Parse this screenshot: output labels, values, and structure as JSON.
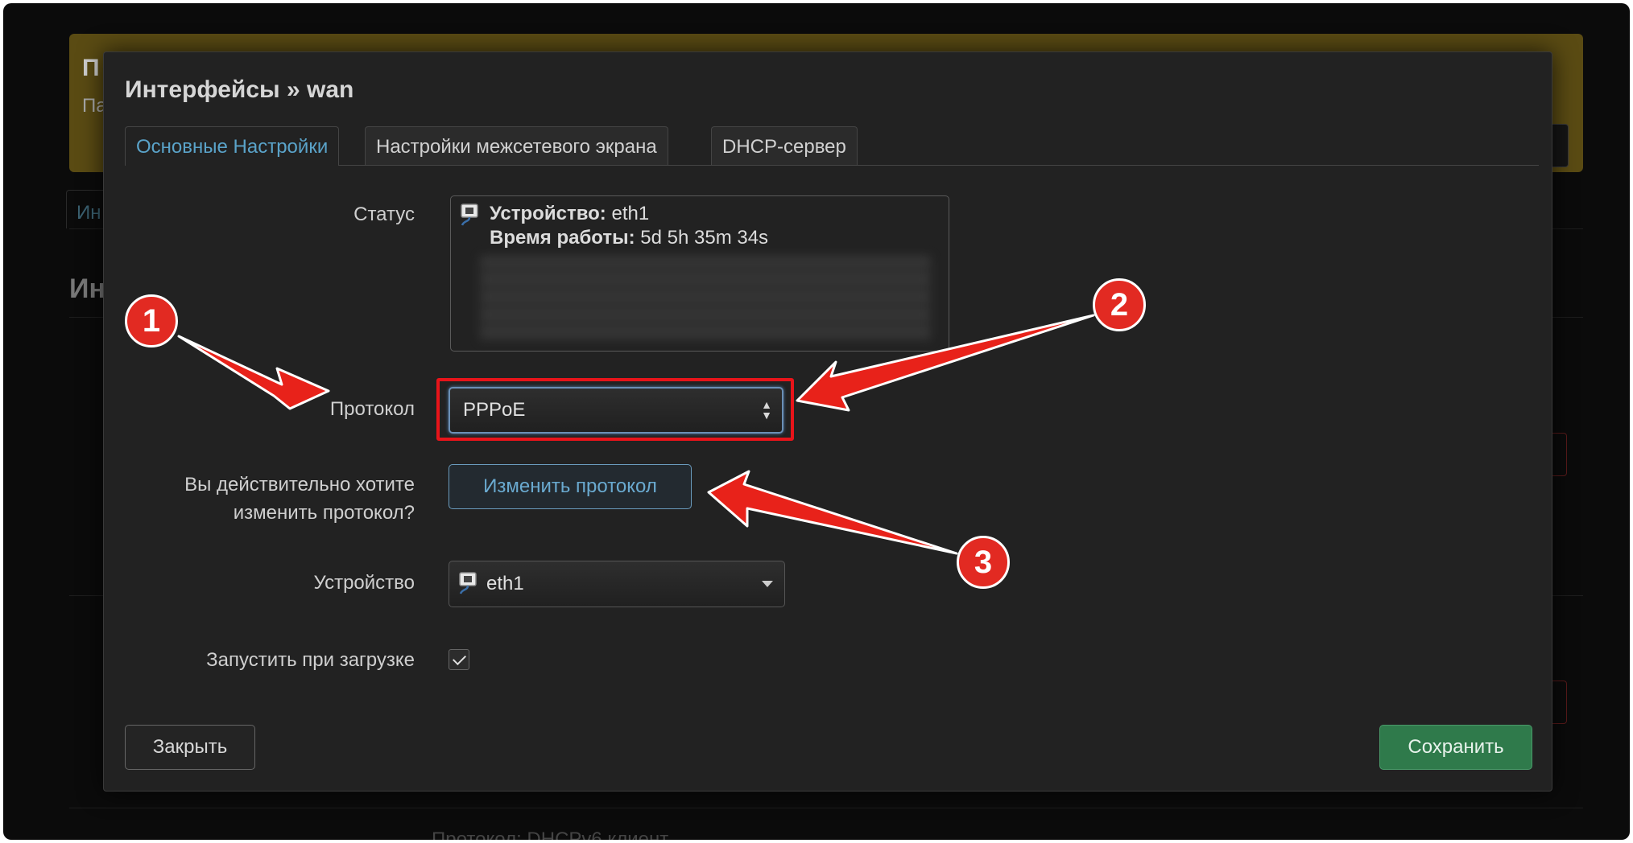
{
  "background": {
    "notice_title_fragment": "П",
    "notice_text_fragment": "Па",
    "tab_fragment": "Ин",
    "heading_fragment": "Ин",
    "footer_fragment": "Протокол: DHCPv6 клиент"
  },
  "modal": {
    "title": "Интерфейсы » wan",
    "tabs": [
      {
        "label": "Основные Настройки",
        "active": true
      },
      {
        "label": "Настройки межсетевого экрана",
        "active": false
      },
      {
        "label": "DHCP-сервер",
        "active": false
      }
    ],
    "status": {
      "label": "Статус",
      "device_key": "Устройство:",
      "device_value": "eth1",
      "uptime_key": "Время работы:",
      "uptime_value": "5d 5h 35m 34s"
    },
    "protocol": {
      "label": "Протокол",
      "selected": "PPPoE"
    },
    "change_protocol": {
      "label_line1": "Вы действительно хотите",
      "label_line2": "изменить протокол?",
      "button": "Изменить протокол"
    },
    "device": {
      "label": "Устройство",
      "selected": "eth1",
      "icon": "ethernet-port-icon"
    },
    "autostart": {
      "label": "Запустить при загрузке",
      "checked": true
    },
    "footer": {
      "close": "Закрыть",
      "save": "Сохранить"
    }
  },
  "annotations": {
    "badges": [
      "1",
      "2",
      "3"
    ],
    "color": "#e22a22"
  }
}
